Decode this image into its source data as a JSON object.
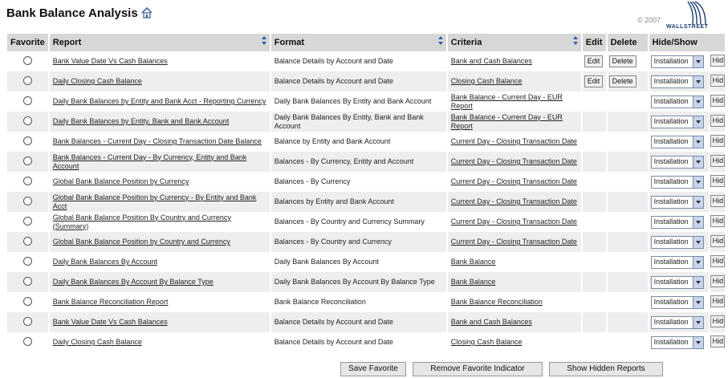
{
  "page": {
    "title": "Bank Balance Analysis"
  },
  "branding": {
    "copyright": "© 2007",
    "name": "WALLSTREET"
  },
  "table": {
    "headers": {
      "favorite": "Favorite",
      "report": "Report",
      "format": "Format",
      "criteria": "Criteria",
      "edit": "Edit",
      "delete": "Delete",
      "hide_show": "Hide/Show"
    },
    "edit_label": "Edit",
    "delete_label": "Delete",
    "select_value": "Installation",
    "hide_label": "Hid",
    "rows": [
      {
        "report": "Bank Value Date Vs Cash Balances",
        "format": "Balance Details by Account and Date",
        "criteria": "Bank and Cash Balances",
        "editable": true
      },
      {
        "report": "Daily Closing Cash Balance",
        "format": "Balance Details by Account and Date",
        "criteria": "Closing Cash Balance",
        "editable": true
      },
      {
        "report": "Daily Bank Balances by Entity and Bank Acct - Reporting Currency",
        "format": "Daily Bank Balances By Entity and Bank Account",
        "criteria": "Bank Balance - Current Day - EUR Report",
        "editable": false
      },
      {
        "report": "Daily Bank Balances by Entity, Bank and Bank Account",
        "format": "Daily Bank Balances By Entity, Bank and Bank Account",
        "criteria": "Bank Balance - Current Day - EUR Report",
        "editable": false
      },
      {
        "report": "Bank Balances - Current Day - Closing Transaction Date Balance",
        "format": "Balance by Entity and Bank Account",
        "criteria": "Current Day - Closing Transaction Date",
        "editable": false
      },
      {
        "report": "Bank Balances - Current Day - By Currency, Entity and Bank Account",
        "format": "Balances - By Currency, Entity and Account",
        "criteria": "Current Day - Closing Transaction Date",
        "editable": false
      },
      {
        "report": "Global Bank Balance Position by Currency",
        "format": "Balances - By Currency",
        "criteria": "Current Day - Closing Transaction Date",
        "editable": false
      },
      {
        "report": "Global Bank Balance Position by Currency - By Entity and Bank Acct",
        "format": "Balances by Entity and Bank Account",
        "criteria": "Current Day - Closing Transaction Date",
        "editable": false
      },
      {
        "report": "Global Bank Balance Position By Country and Currency (Summary)",
        "format": "Balances - By Country and Currency Summary",
        "criteria": "Current Day - Closing Transaction Date",
        "editable": false
      },
      {
        "report": "Global Bank Balance Position by Country and Currency",
        "format": "Balances - By Country and Currency",
        "criteria": "Current Day - Closing Transaction Date",
        "editable": false
      },
      {
        "report": "Daily Bank Balances By Account",
        "format": "Daily Bank Balances By Account",
        "criteria": "Bank Balance",
        "editable": false
      },
      {
        "report": "Daily Bank Balances By Account By Balance Type",
        "format": "Daily Bank Balances By Account By Balance Type",
        "criteria": "Bank Balance",
        "editable": false
      },
      {
        "report": "Bank Balance Reconciliation Report",
        "format": "Bank Balance Reconciliation",
        "criteria": "Bank Balance Reconciliation",
        "editable": false
      },
      {
        "report": "Bank Value Date Vs Cash Balances",
        "format": "Balance Details by Account and Date",
        "criteria": "Bank and Cash Balances",
        "editable": false
      },
      {
        "report": "Daily Closing Cash Balance",
        "format": "Balance Details by Account and Date",
        "criteria": "Closing Cash Balance",
        "editable": false
      }
    ]
  },
  "footer": {
    "save": "Save Favorite",
    "remove": "Remove Favorite Indicator",
    "show_hidden": "Show Hidden Reports"
  }
}
